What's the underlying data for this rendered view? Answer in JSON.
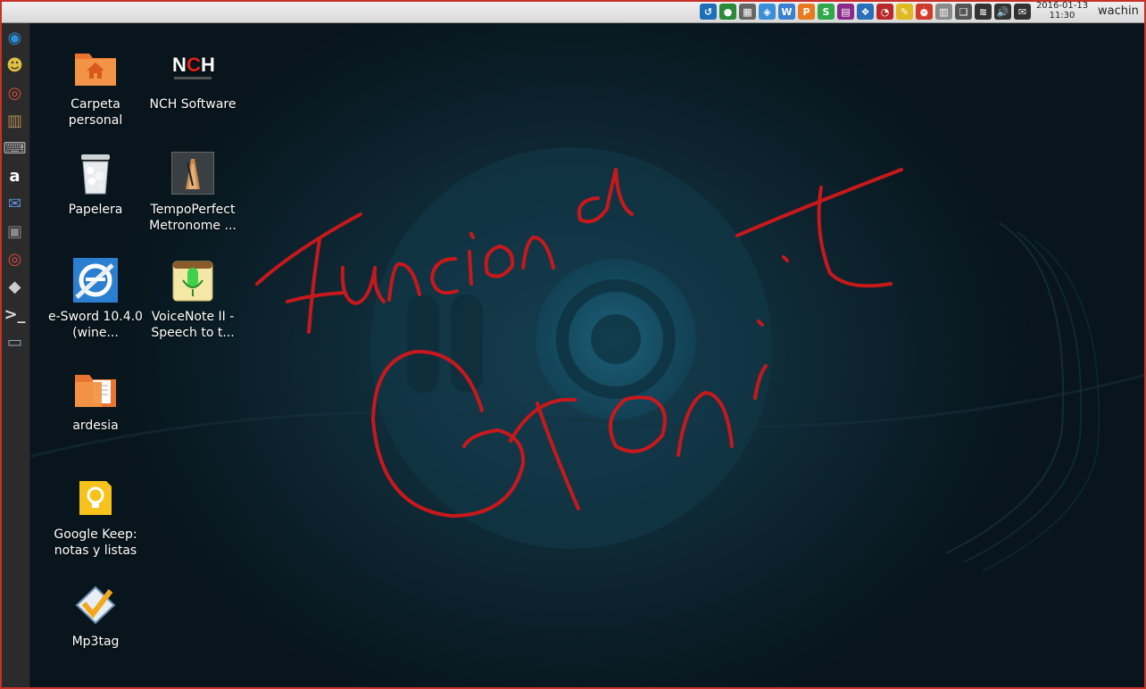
{
  "top_panel": {
    "tray_icons": [
      {
        "name": "teamviewer-icon",
        "glyph": "↺",
        "color": "#1e6fb8"
      },
      {
        "name": "globe-icon",
        "glyph": "●",
        "color": "#2a8a3a"
      },
      {
        "name": "calculator-icon",
        "glyph": "▦",
        "color": "#666666"
      },
      {
        "name": "remote-icon",
        "glyph": "◈",
        "color": "#3b8fd6"
      },
      {
        "name": "wps-writer-icon",
        "glyph": "W",
        "color": "#3a7fd0"
      },
      {
        "name": "wps-presentation-icon",
        "glyph": "P",
        "color": "#e87a1f"
      },
      {
        "name": "wps-spreadsheet-icon",
        "glyph": "S",
        "color": "#2ea84a"
      },
      {
        "name": "screen-recorder-icon",
        "glyph": "▤",
        "color": "#8a2a8a"
      },
      {
        "name": "dropbox-icon",
        "glyph": "❖",
        "color": "#2a6fb8"
      },
      {
        "name": "mpx-meter-icon",
        "glyph": "◔",
        "color": "#b82a2a"
      },
      {
        "name": "notes-icon",
        "glyph": "✎",
        "color": "#e0b820"
      },
      {
        "name": "alarm-clock-icon",
        "glyph": "⏰",
        "color": "#d23a2a"
      },
      {
        "name": "clipboard-icon",
        "glyph": "▥",
        "color": "#8a8a8a"
      },
      {
        "name": "book-icon",
        "glyph": "❑",
        "color": "#555555"
      },
      {
        "name": "wifi-icon",
        "glyph": "≋",
        "color": "#333333"
      },
      {
        "name": "volume-icon",
        "glyph": "🔊",
        "color": "#333333"
      },
      {
        "name": "mail-icon",
        "glyph": "✉",
        "color": "#333333"
      }
    ],
    "date": "2016-01-13",
    "time": "11:30",
    "username": "wachin"
  },
  "launcher": {
    "items": [
      {
        "name": "ubuntu-studio-icon",
        "glyph": "◉",
        "color": "#2a8fd6"
      },
      {
        "name": "tux-icon",
        "glyph": "☻",
        "color": "#e0c040"
      },
      {
        "name": "chrome-icon",
        "glyph": "◎",
        "color": "#d94a3a"
      },
      {
        "name": "book-reader-icon",
        "glyph": "▥",
        "color": "#b08a50"
      },
      {
        "name": "keyboard-icon",
        "glyph": "⌨",
        "color": "#aaaaaa"
      },
      {
        "name": "amazon-icon",
        "glyph": "a",
        "color": "#ffffff"
      },
      {
        "name": "email-icon",
        "glyph": "✉",
        "color": "#5a8ed6"
      },
      {
        "name": "scanner-icon",
        "glyph": "▣",
        "color": "#888888"
      },
      {
        "name": "chrome-icon",
        "glyph": "◎",
        "color": "#d94a3a"
      },
      {
        "name": "inkscape-icon",
        "glyph": "◆",
        "color": "#cccccc"
      },
      {
        "name": "terminal-icon",
        "glyph": ">_",
        "color": "#dddddd"
      },
      {
        "name": "window-icon",
        "glyph": "▭",
        "color": "#9ab"
      }
    ]
  },
  "desktop": {
    "icons": [
      {
        "name": "carpeta-personal",
        "label": "Carpeta personal",
        "icon": "home-folder-icon"
      },
      {
        "name": "nch-software",
        "label": "NCH Software",
        "icon": "nch-logo-icon"
      },
      {
        "name": "papelera",
        "label": "Papelera",
        "icon": "trash-icon"
      },
      {
        "name": "tempoperfect",
        "label": "TempoPerfect Metronome ...",
        "icon": "metronome-icon"
      },
      {
        "name": "e-sword",
        "label": "e-Sword 10.4.0 (wine...",
        "icon": "e-sword-icon"
      },
      {
        "name": "voicenote",
        "label": "VoiceNote II - Speech to t...",
        "icon": "microphone-icon"
      },
      {
        "name": "ardesia",
        "label": "ardesia",
        "icon": "folder-icon"
      },
      {
        "name": "google-keep",
        "label": "Google Keep: notas y listas",
        "icon": "keep-bulb-icon"
      },
      {
        "name": "mp3tag",
        "label": "Mp3tag",
        "icon": "mp3tag-icon"
      }
    ]
  },
  "colors": {
    "panel": "#e4e4e4",
    "launcher": "#2b2b2b",
    "handwriting": "#c8181c",
    "frame": "#c8302a"
  }
}
